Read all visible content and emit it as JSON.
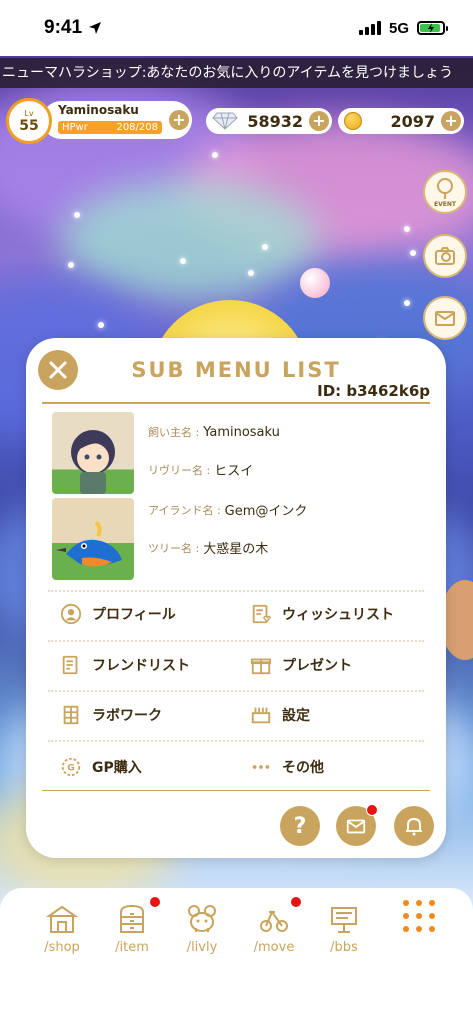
{
  "status_bar": {
    "time": "9:41",
    "network": "5G"
  },
  "marquee": {
    "text": "ニューマハラショップ:あなたのお気に入りのアイテムを見つけましょう"
  },
  "hud": {
    "level_label": "Lv",
    "level": "55",
    "player_name": "Yaminosaku",
    "hp_label": "HPwr",
    "hp_value": "208/208",
    "hp_fraction": 1.0,
    "gems": "58932",
    "coins": "2097"
  },
  "side_buttons": {
    "event_label": "EVENT"
  },
  "panel": {
    "title": "SUB MENU LIST",
    "id": "ID: b3462k6p",
    "owner_key": "飼い主名 :",
    "owner_value": "Yaminosaku",
    "rivery_key": "リヴリー名 :",
    "rivery_value": "ヒスイ",
    "island_key": "アイランド名 :",
    "island_value": "Gem@インク",
    "tree_key": "ツリー名 :",
    "tree_value": "大惑星の木",
    "menu": [
      {
        "label": "プロフィール",
        "icon": "profile-icon"
      },
      {
        "label": "ウィッシュリスト",
        "icon": "wishlist-icon"
      },
      {
        "label": "フレンドリスト",
        "icon": "friend-list-icon"
      },
      {
        "label": "プレゼント",
        "icon": "gift-icon"
      },
      {
        "label": "ラボワーク",
        "icon": "lab-work-icon"
      },
      {
        "label": "設定",
        "icon": "settings-icon"
      },
      {
        "label": "GP購入",
        "icon": "gp-coin-icon"
      },
      {
        "label": "その他",
        "icon": "more-icon"
      }
    ],
    "help_label": "?"
  },
  "bottom_nav": [
    {
      "label": "/shop",
      "icon": "shop-icon"
    },
    {
      "label": "/item",
      "icon": "item-icon"
    },
    {
      "label": "/livly",
      "icon": "livly-icon"
    },
    {
      "label": "/move",
      "icon": "move-icon"
    },
    {
      "label": "/bbs",
      "icon": "bbs-icon"
    }
  ],
  "colors": {
    "accent": "#c9a45e",
    "orange": "#f08a1c",
    "badge": "#e81414"
  }
}
